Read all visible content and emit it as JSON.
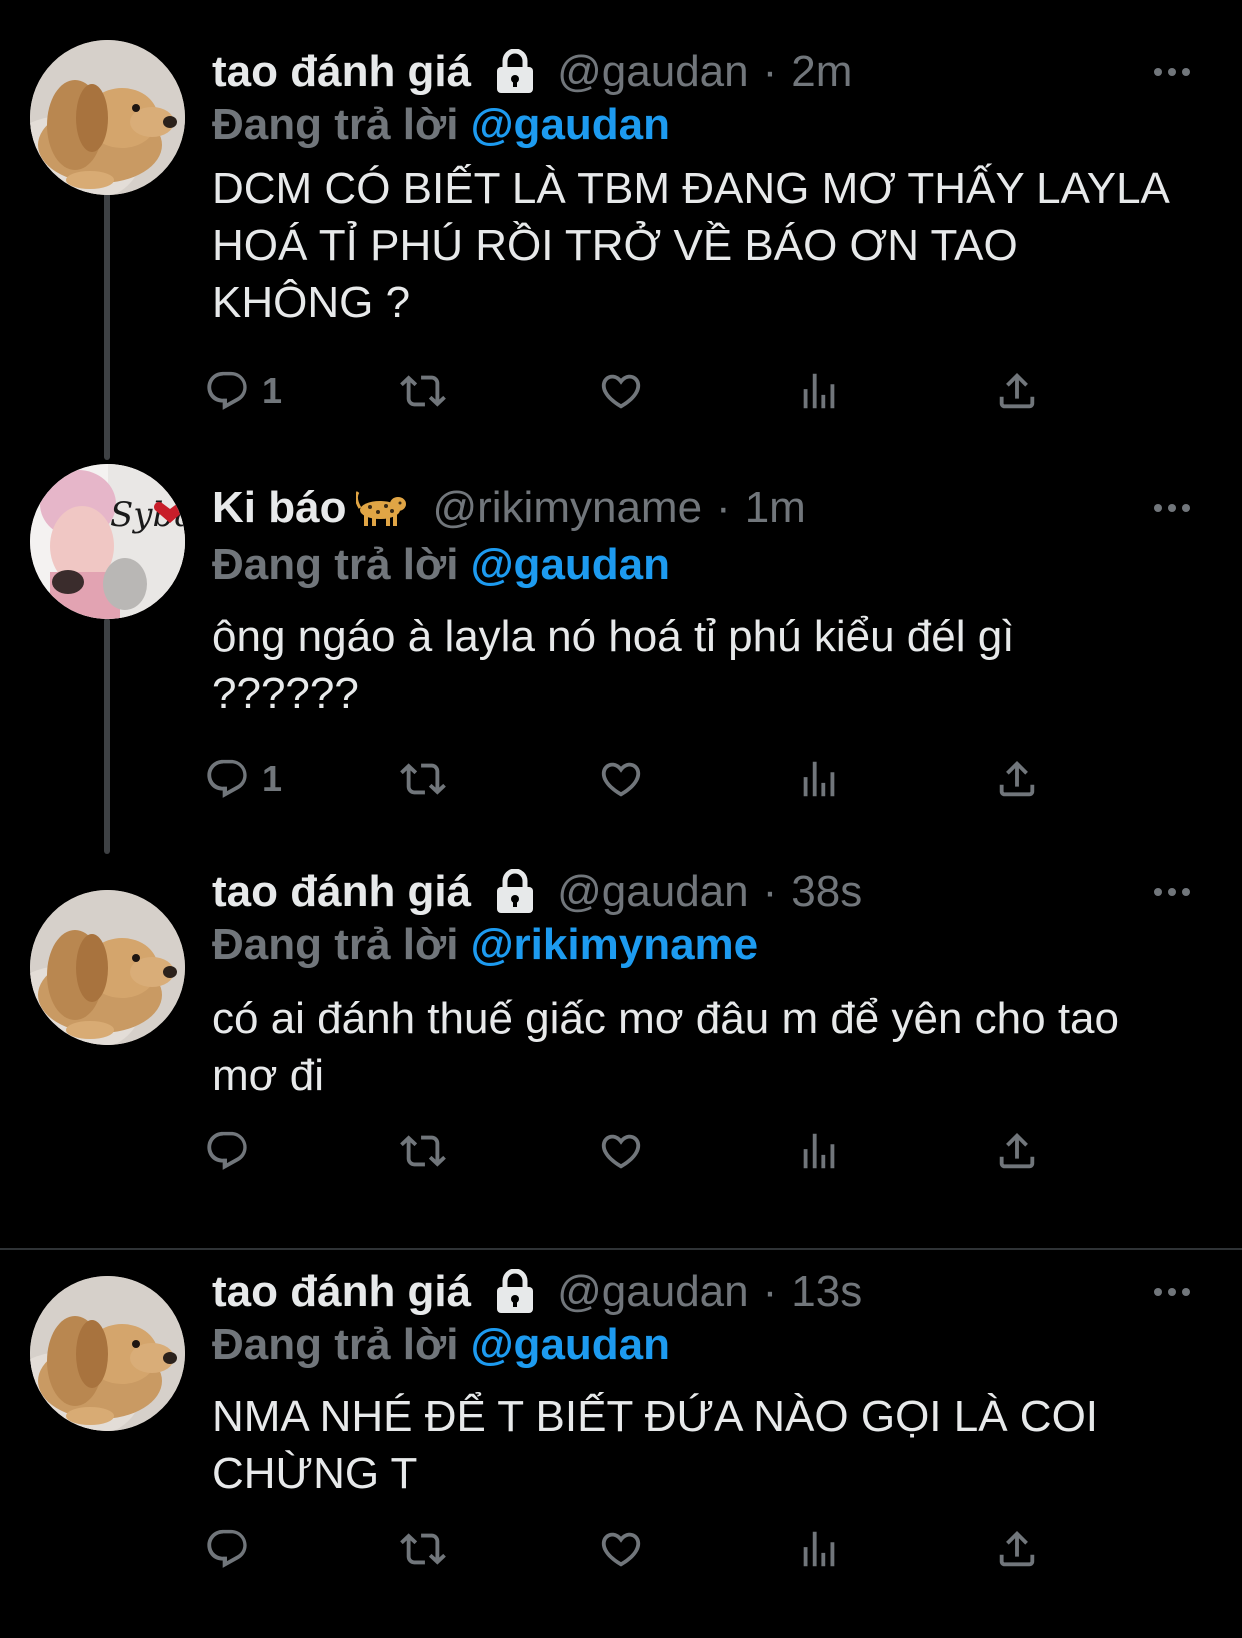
{
  "colors": {
    "background": "#000000",
    "text": "#e7e9ea",
    "muted": "#71767b",
    "accent": "#1d9bf0",
    "thread_line": "#3e4144"
  },
  "tweets": [
    {
      "name": "tao đánh giá",
      "protected_icon": "lock-icon",
      "handle": "@gaudan",
      "dot": "·",
      "time": "2m",
      "reply_prefix": "Đang trả lời ",
      "reply_to": "@gaudan",
      "text": "DCM CÓ BIẾT LÀ TBM ĐANG MƠ THẤY LAYLA HOÁ TỈ PHÚ RỒI TRỞ VỀ BÁO ƠN TAO KHÔNG ?",
      "reply_count": "1",
      "avatar": "dog-avatar"
    },
    {
      "name": "Ki báo",
      "name_emoji": "leopard-emoji",
      "handle": "@rikimyname",
      "dot": "·",
      "time": "1m",
      "reply_prefix": "Đang trả lời ",
      "reply_to": "@gaudan",
      "text": "ông ngáo à layla nó hoá tỉ phú kiểu đél gì ??????",
      "reply_count": "1",
      "avatar": "person-avatar",
      "avatar_text": "Sybau"
    },
    {
      "name": "tao đánh giá",
      "protected_icon": "lock-icon",
      "handle": "@gaudan",
      "dot": "·",
      "time": "38s",
      "reply_prefix": "Đang trả lời ",
      "reply_to": "@rikimyname",
      "text": "có ai đánh thuế giấc mơ đâu m để yên cho tao mơ đi",
      "reply_count": "",
      "avatar": "dog-avatar"
    },
    {
      "name": "tao đánh giá",
      "protected_icon": "lock-icon",
      "handle": "@gaudan",
      "dot": "·",
      "time": "13s",
      "reply_prefix": "Đang trả lời ",
      "reply_to": "@gaudan",
      "text": "NMA NHÉ ĐỂ T BIẾT ĐỨA NÀO GỌI LÀ COI CHỪNG T",
      "reply_count": "",
      "avatar": "dog-avatar"
    }
  ],
  "action_icons": [
    "reply-icon",
    "retweet-icon",
    "like-icon",
    "views-icon",
    "share-icon"
  ]
}
